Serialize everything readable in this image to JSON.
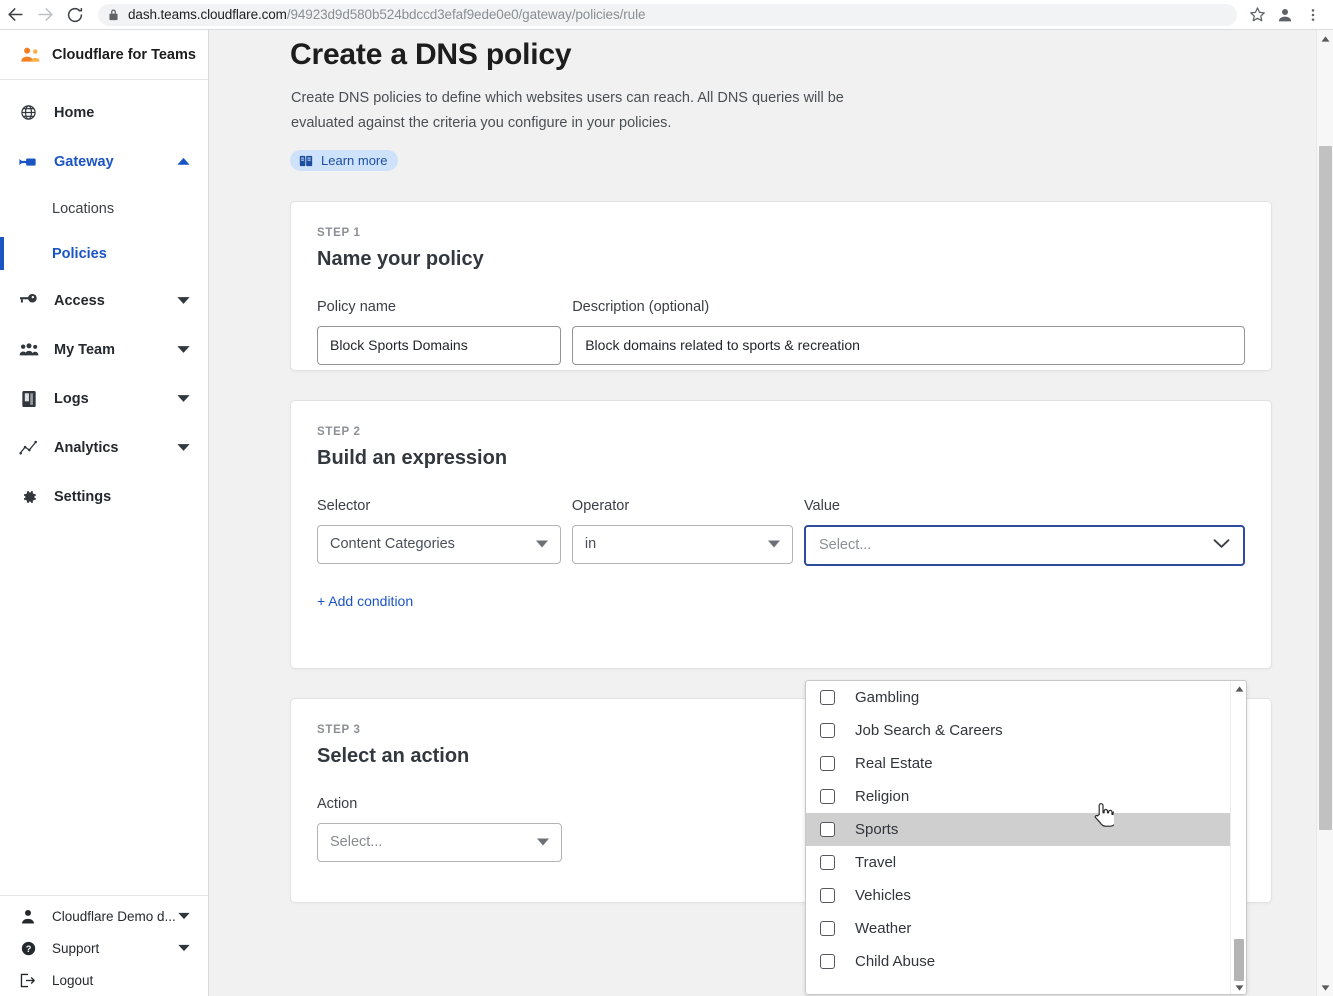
{
  "browser": {
    "back_icon": "arrow-left-icon",
    "forward_icon": "arrow-right-icon",
    "reload_icon": "reload-icon",
    "lock_icon": "lock-icon",
    "url_host": "dash.teams.cloudflare.com",
    "url_path": "/94923d9d580b524bdccd3efaf9ede0e0/gateway/policies/rule",
    "bookmark_icon": "star-icon",
    "profile_icon": "profile-avatar-icon",
    "menu_icon": "three-dots-menu-icon"
  },
  "sidebar": {
    "brand": "Cloudflare for Teams",
    "brand_icon": "team-people-icon",
    "items": [
      {
        "label": "Home",
        "icon": "globe-icon",
        "chevron": "none",
        "active": false
      },
      {
        "label": "Gateway",
        "icon": "gateway-icon",
        "chevron": "up",
        "active": true
      },
      {
        "label": "Access",
        "icon": "key-icon",
        "chevron": "down",
        "active": false
      },
      {
        "label": "My Team",
        "icon": "people-group-icon",
        "chevron": "down",
        "active": false
      },
      {
        "label": "Logs",
        "icon": "book-icon",
        "chevron": "down",
        "active": false
      },
      {
        "label": "Analytics",
        "icon": "line-chart-icon",
        "chevron": "down",
        "active": false
      },
      {
        "label": "Settings",
        "icon": "gear-icon",
        "chevron": "none",
        "active": false
      }
    ],
    "gateway_subitems": [
      {
        "label": "Locations",
        "active": false
      },
      {
        "label": "Policies",
        "active": true
      }
    ],
    "bottom_items": [
      {
        "label": "Cloudflare Demo d...",
        "icon": "user-icon",
        "chevron": "down"
      },
      {
        "label": "Support",
        "icon": "question-circle-icon",
        "chevron": "down"
      },
      {
        "label": "Logout",
        "icon": "logout-icon",
        "chevron": "none"
      }
    ]
  },
  "page": {
    "title": "Create a DNS policy",
    "description": "Create DNS policies to define which websites users can reach. All DNS queries will be evaluated against the criteria you configure in your policies.",
    "learn_more": "Learn more",
    "learn_more_icon": "book-icon"
  },
  "step1": {
    "step_label": "STEP 1",
    "title": "Name your policy",
    "policy_name_label": "Policy name",
    "policy_name_value": "Block Sports Domains",
    "policy_name_placeholder": "Policy name",
    "description_label": "Description (optional)",
    "description_value": "Block domains related to sports & recreation",
    "description_placeholder": "Description"
  },
  "step2": {
    "step_label": "STEP 2",
    "title": "Build an expression",
    "selector_label": "Selector",
    "selector_value": "Content Categories",
    "operator_label": "Operator",
    "operator_value": "in",
    "value_label": "Value",
    "value_placeholder": "Select...",
    "add_condition": "+ Add condition",
    "focus_border_color": "#2f4b9e"
  },
  "step3": {
    "step_label": "STEP 3",
    "title": "Select an action",
    "action_label": "Action",
    "action_value": "Select..."
  },
  "dropdown": {
    "hovered_index": 4,
    "options": [
      {
        "label": "Gambling",
        "checked": false
      },
      {
        "label": "Job Search & Careers",
        "checked": false
      },
      {
        "label": "Real Estate",
        "checked": false
      },
      {
        "label": "Religion",
        "checked": false
      },
      {
        "label": "Sports",
        "checked": false
      },
      {
        "label": "Travel",
        "checked": false
      },
      {
        "label": "Vehicles",
        "checked": false
      },
      {
        "label": "Weather",
        "checked": false
      },
      {
        "label": "Child Abuse",
        "checked": false
      }
    ],
    "scroll_up_icon": "scroll-up-arrow-icon",
    "scroll_down_icon": "scroll-down-arrow-icon"
  },
  "cursor": {
    "icon": "pointing-hand-cursor"
  },
  "colors": {
    "accent_blue": "#1b55c4",
    "focus_blue": "#2f4b9e",
    "brand_orange": "#f38020",
    "page_background": "#f1f1f1",
    "card_background": "#ffffff",
    "pill_background": "#cfe2fb"
  }
}
